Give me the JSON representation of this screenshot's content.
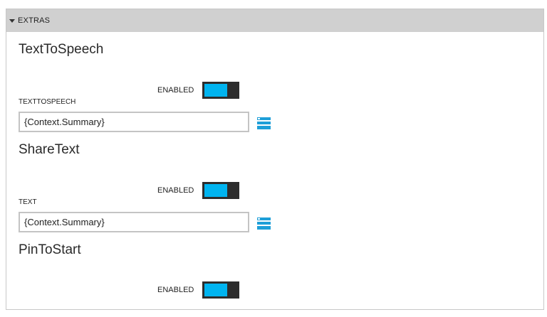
{
  "panel": {
    "title": "EXTRAS"
  },
  "sections": [
    {
      "title": "TextToSpeech",
      "enabled_label": "ENABLED",
      "enabled": true,
      "field_label": "TEXTTOSPEECH",
      "field_value": "{Context.Summary}"
    },
    {
      "title": "ShareText",
      "enabled_label": "ENABLED",
      "enabled": true,
      "field_label": "TEXT",
      "field_value": "{Context.Summary}"
    },
    {
      "title": "PinToStart",
      "enabled_label": "ENABLED",
      "enabled": true
    }
  ],
  "colors": {
    "toggle_on": "#00b4f0",
    "toggle_track": "#2d2d2d",
    "header_bg": "#d0d0d0",
    "bind_icon": "#1e9fd8"
  },
  "icons": {
    "collapse": "caret-down-icon",
    "data_binding": "data-binding-icon"
  }
}
